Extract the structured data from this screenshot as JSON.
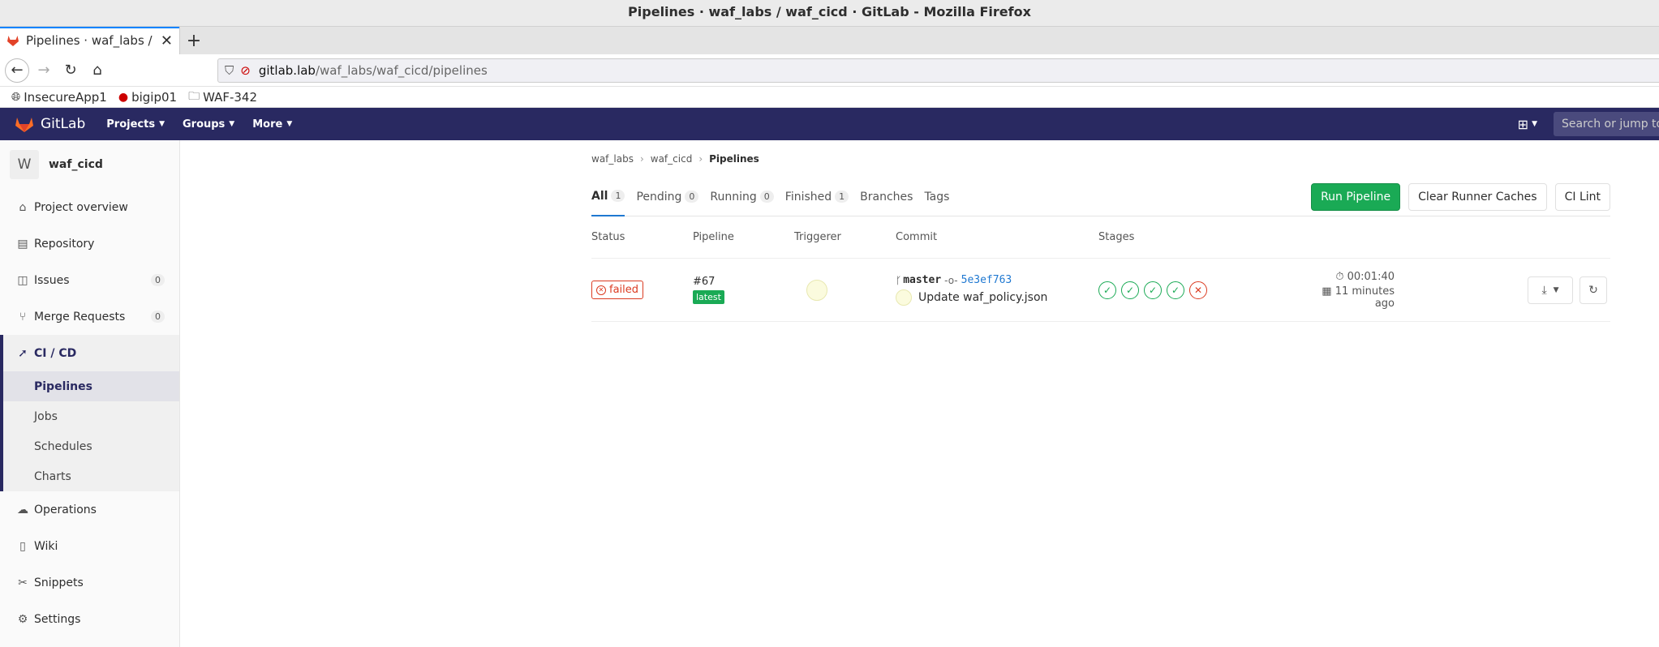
{
  "window": {
    "title": "Pipelines · waf_labs / waf_cicd · GitLab - Mozilla Firefox"
  },
  "browser": {
    "tab_title": "Pipelines · waf_labs / w",
    "url_host": "gitlab.lab",
    "url_path": "/waf_labs/waf_cicd/pipelines",
    "bookmarks": [
      "InsecureApp1",
      "bigip01",
      "WAF-342"
    ]
  },
  "gitlab": {
    "brand": "GitLab",
    "nav": [
      "Projects",
      "Groups",
      "More"
    ],
    "search_placeholder": "Search or jump to..."
  },
  "sidebar": {
    "avatar_letter": "W",
    "project_name": "waf_cicd",
    "items": [
      {
        "label": "Project overview",
        "icon": "home-icon"
      },
      {
        "label": "Repository",
        "icon": "book-icon"
      },
      {
        "label": "Issues",
        "icon": "issues-icon",
        "count": "0"
      },
      {
        "label": "Merge Requests",
        "icon": "merge-request-icon",
        "count": "0"
      }
    ],
    "cicd": {
      "label": "CI / CD",
      "subs": [
        "Pipelines",
        "Jobs",
        "Schedules",
        "Charts"
      ]
    },
    "bottom_items": [
      "Operations",
      "Wiki",
      "Snippets",
      "Settings"
    ]
  },
  "breadcrumb": [
    "waf_labs",
    "waf_cicd",
    "Pipelines"
  ],
  "tabs": [
    {
      "label": "All",
      "count": "1"
    },
    {
      "label": "Pending",
      "count": "0"
    },
    {
      "label": "Running",
      "count": "0"
    },
    {
      "label": "Finished",
      "count": "1"
    },
    {
      "label": "Branches"
    },
    {
      "label": "Tags"
    }
  ],
  "buttons": {
    "run": "Run Pipeline",
    "clear": "Clear Runner Caches",
    "lint": "CI Lint"
  },
  "table": {
    "headers": [
      "Status",
      "Pipeline",
      "Triggerer",
      "Commit",
      "Stages"
    ],
    "row": {
      "status": "failed",
      "pipeline_id": "#67",
      "tag": "latest",
      "branch": "master",
      "sha": "5e3ef763",
      "message": "Update waf_policy.json",
      "stages": [
        "passed",
        "passed",
        "passed",
        "passed",
        "failed"
      ],
      "duration": "00:01:40",
      "finished": "11 minutes ago"
    }
  },
  "colors": {
    "header": "#292961",
    "success": "#1aaa55",
    "danger": "#db3b21",
    "link": "#1f78d1"
  }
}
